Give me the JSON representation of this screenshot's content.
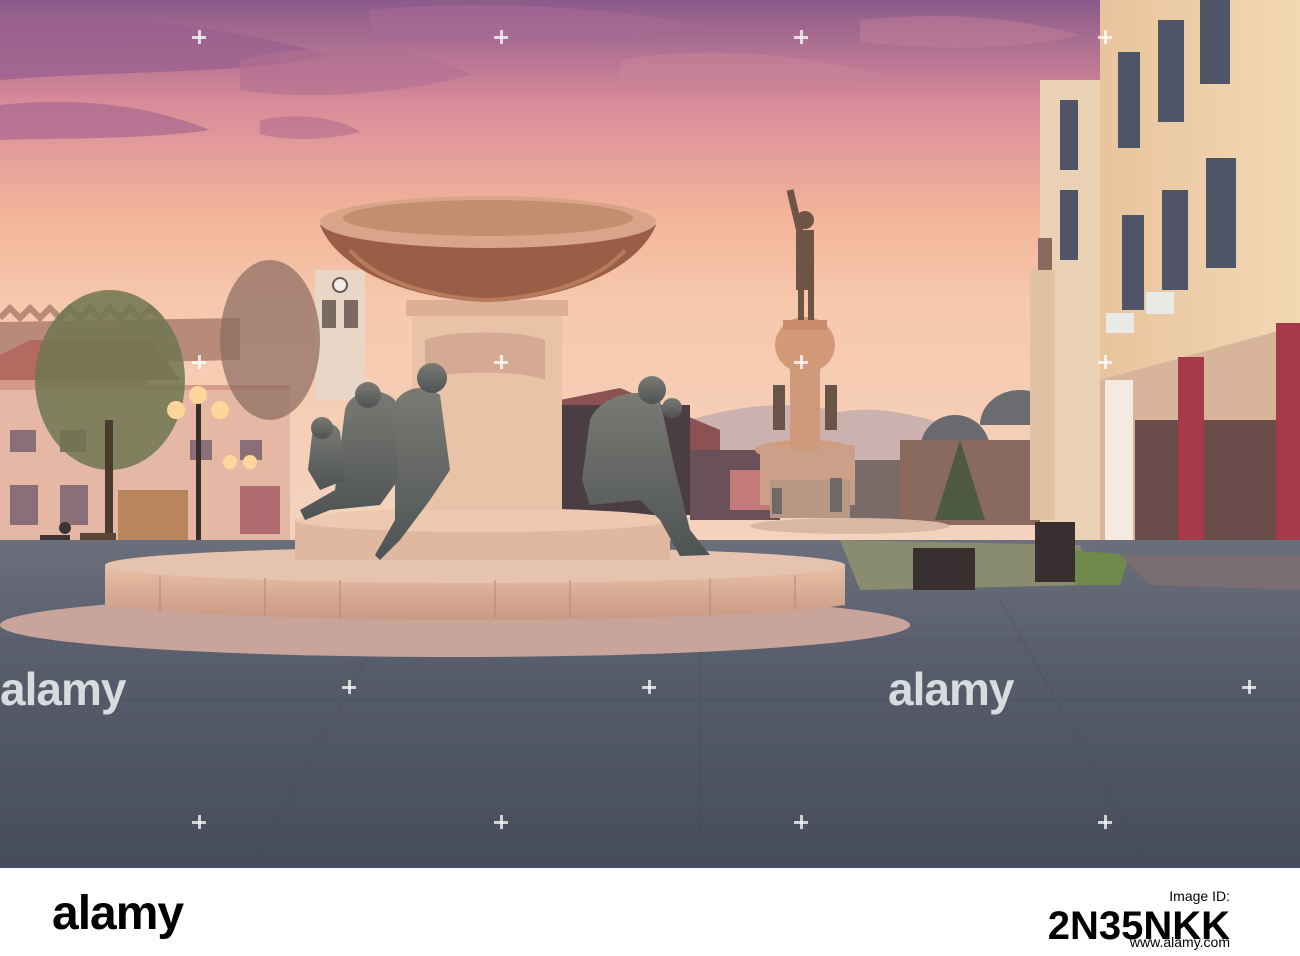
{
  "watermark": {
    "brand": "alamy"
  },
  "footer": {
    "logo": "alamy",
    "label": "Image ID:",
    "image_id": "2N35NKK",
    "url": "www.alamy.com"
  },
  "colors": {
    "sky_top": "#7a5a8c",
    "sky_mid": "#f2b49a",
    "sky_low": "#f7d0b0",
    "pavement": "#53596a"
  }
}
